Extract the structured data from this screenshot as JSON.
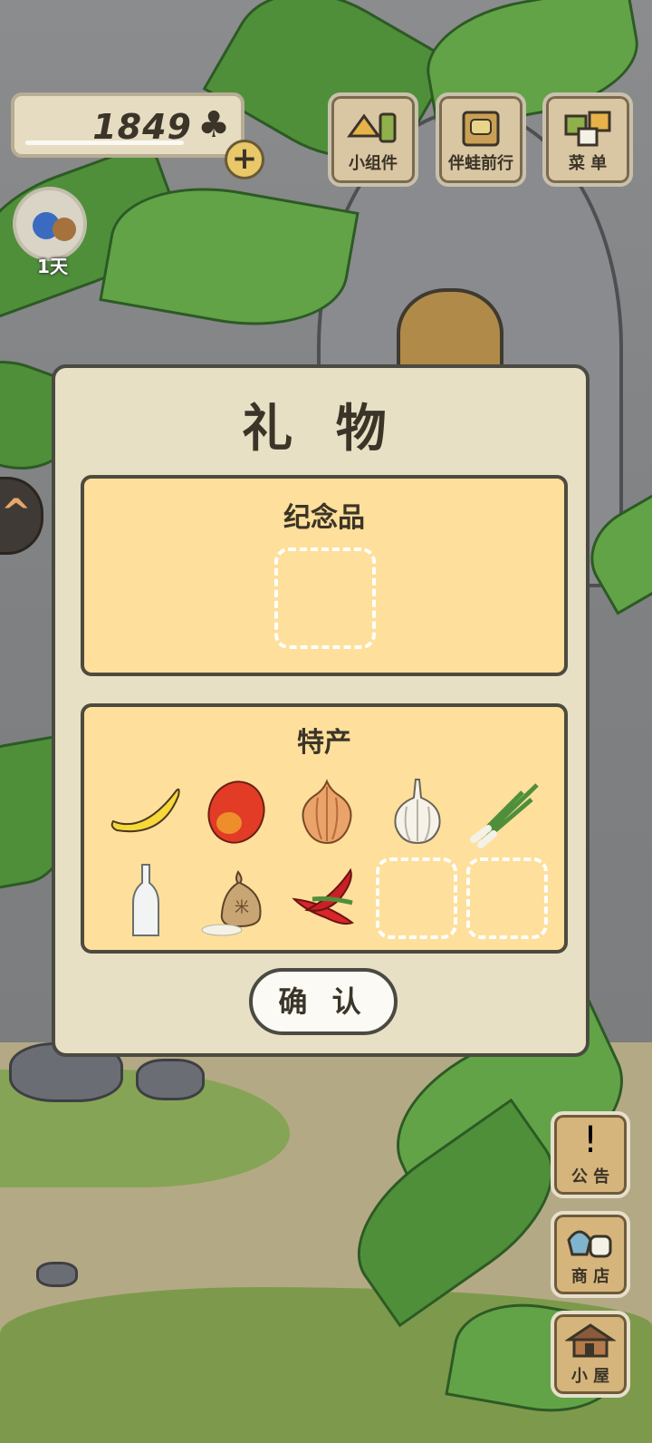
{
  "hud": {
    "clover_count": "1849",
    "clover_icon": "clover-icon",
    "plus_label": "+",
    "day_label": "1天",
    "buttons": [
      {
        "name": "widgets-button",
        "icon": "widgets-icon",
        "label": "小组件"
      },
      {
        "name": "companion-button",
        "icon": "companion-icon",
        "label": "伴蛙前行"
      },
      {
        "name": "menu-button",
        "icon": "menu-icon",
        "label": "菜 单"
      }
    ]
  },
  "dialog": {
    "title": "礼 物",
    "souvenir": {
      "title": "纪念品"
    },
    "specialty": {
      "title": "特产",
      "items": [
        {
          "name": "banana-item",
          "icon": "banana"
        },
        {
          "name": "mango-item",
          "icon": "mango"
        },
        {
          "name": "onion-item",
          "icon": "onion"
        },
        {
          "name": "garlic-item",
          "icon": "garlic"
        },
        {
          "name": "green-onion-item",
          "icon": "green-onion"
        },
        {
          "name": "bottle-item",
          "icon": "bottle"
        },
        {
          "name": "rice-bag-item",
          "icon": "rice-bag",
          "bag_text": "米"
        },
        {
          "name": "chili-item",
          "icon": "chili"
        }
      ]
    },
    "confirm_label": "确 认"
  },
  "side": {
    "buttons": [
      {
        "name": "notice-button",
        "icon": "exclamation-icon",
        "glyph": "!",
        "label": "公 告"
      },
      {
        "name": "shop-button",
        "icon": "shop-bags-icon",
        "label": "商 店"
      },
      {
        "name": "house-button",
        "icon": "house-icon",
        "label": "小 屋"
      }
    ]
  },
  "colors": {
    "panel_fill": "#fedf9b",
    "dialog_fill": "#e8e0c4",
    "outline": "#4a4a42"
  }
}
